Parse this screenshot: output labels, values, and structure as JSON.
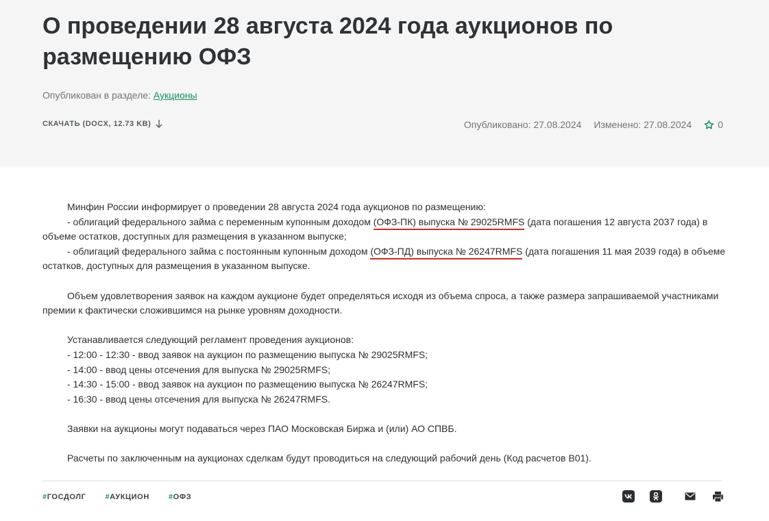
{
  "header": {
    "title": "О проведении 28 августа 2024 года аукционов по размещению ОФЗ",
    "section_prefix": "Опубликован в разделе:",
    "section_link": "Аукционы",
    "download_label": "СКАЧАТЬ (DOCX, 12.73 KB)",
    "published": "Опубликовано: 27.08.2024",
    "modified": "Изменено: 27.08.2024",
    "favorites_count": "0"
  },
  "article": {
    "intro": "Минфин России информирует о проведении 28 августа 2024 года аукционов по размещению:",
    "item1_pre": "- облигаций федерального займа с переменным купонным доходом ",
    "item1_hl": "(ОФЗ-ПК) выпуска № 29025RMFS",
    "item1_post": " (дата погашения 12 августа 2037 года) в объеме остатков, доступных для размещения в указанном выпуске;",
    "item2_pre": "- облигаций федерального займа с постоянным купонным доходом ",
    "item2_hl": "(ОФЗ-ПД) выпуска № 26247RMFS",
    "item2_post": " (дата погашения 11 мая 2039 года) в объеме остатков, доступных для размещения в указанном выпуске.",
    "para2": "Объем удовлетворения заявок на каждом аукционе будет определяться исходя из объема спроса, а также размера запрашиваемой участниками премии к фактически сложившимся на рынке уровням доходности.",
    "schedule_title": "Устанавливается следующий регламент проведения аукционов:",
    "schedule": [
      "- 12:00 - 12:30 - ввод заявок на аукцион по размещению выпуска № 29025RMFS;",
      "- 14:00 - ввод цены отсечения для выпуска № 29025RMFS;",
      "- 14:30 - 15:00 - ввод заявок на аукцион по размещению выпуска № 26247RMFS;",
      "- 16:30 - ввод цены отсечения для выпуска № 26247RMFS."
    ],
    "para4": "Заявки на аукционы могут подаваться через ПАО Московская Биржа и (или) АО СПВБ.",
    "para5": "Расчеты по заключенным на аукционах сделкам будут проводиться на следующий рабочий день (Код расчетов B01)."
  },
  "footer": {
    "tags": [
      "ГОСДОЛГ",
      "АУКЦИОН",
      "ОФЗ"
    ],
    "share_icons": [
      "vk-icon",
      "odnoklassniki-icon",
      "mail-icon",
      "print-icon"
    ]
  },
  "colors": {
    "accent": "#10925e",
    "highlight": "#d62b1e",
    "header_bg": "#f5f5f5"
  }
}
